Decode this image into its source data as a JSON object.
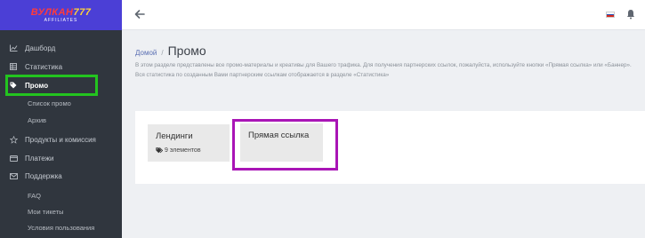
{
  "logo": {
    "main_prefix": "ВУЛКАН",
    "main_number": "777",
    "sub": "AFFILIATES"
  },
  "header": {
    "back_icon": "arrow-left-icon",
    "flag_colors": [
      "#ffffff",
      "#1c4fb8",
      "#d52b1e"
    ],
    "bell_icon": "bell-icon"
  },
  "sidebar": {
    "items": [
      {
        "label": "Дашборд",
        "icon": "line-chart-icon"
      },
      {
        "label": "Статистика",
        "icon": "table-icon"
      },
      {
        "label": "Промо",
        "icon": "tag-icon",
        "active": true
      },
      {
        "label": "Список промо"
      },
      {
        "label": "Архив"
      },
      {
        "label": "Продукты и комиссия",
        "icon": "star-icon"
      },
      {
        "label": "Платежи",
        "icon": "credit-card-icon"
      },
      {
        "label": "Поддержка",
        "icon": "envelope-icon"
      },
      {
        "label": "FAQ"
      },
      {
        "label": "Мои тикеты"
      },
      {
        "label": "Условия пользования"
      }
    ]
  },
  "breadcrumb": {
    "home": "Домой",
    "separator": "/",
    "current": "Промо"
  },
  "intro": "В этом разделе представлены все промо-материалы и креативы для Вашего трафика. Для получения партнерских ссылок, пожалуйста, используйте кнопки «Прямая ссылка» или «Баннер». Вся статистика по созданным Вами партнерским ссылкам отображается в разделе «Статистика»",
  "cards": [
    {
      "title": "Лендинги",
      "meta": "9 элементов",
      "icon": "tags-icon"
    },
    {
      "title": "Прямая ссылка"
    }
  ],
  "highlight_colors": {
    "green": "#23c41f",
    "purple": "#a915b6"
  }
}
